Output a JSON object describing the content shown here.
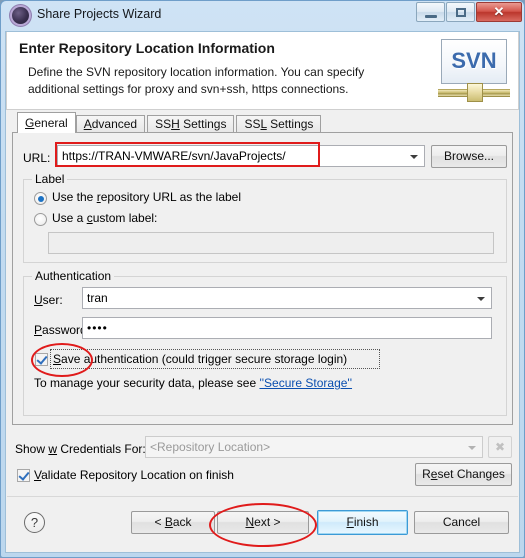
{
  "window": {
    "title": "Share Projects Wizard",
    "icon": "svn-repository-icon",
    "buttons": {
      "minimize": "minimize-icon",
      "maximize": "restore-icon",
      "close": "✕"
    }
  },
  "header": {
    "title": "Enter Repository Location Information",
    "description": "Define the SVN repository location information. You can specify additional settings for proxy and svn+ssh, https connections.",
    "badge_text": "SVN"
  },
  "tabs": [
    {
      "label_pre": "",
      "label_key": "G",
      "label_post": "eneral",
      "selected": true
    },
    {
      "label_pre": "",
      "label_key": "A",
      "label_post": "dvanced",
      "selected": false
    },
    {
      "label_pre": "SS",
      "label_key": "H",
      "label_post": " Settings",
      "selected": false
    },
    {
      "label_pre": "SS",
      "label_key": "L",
      "label_post": " Settings",
      "selected": false
    }
  ],
  "general": {
    "url_label": "URL:",
    "url_value": "https://TRAN-VMWARE/svn/JavaProjects/",
    "browse_label": "Browse...",
    "label_group": {
      "title": "Label",
      "radio_url_pre": "Use the ",
      "radio_url_key": "r",
      "radio_url_post": "epository URL as the label",
      "radio_url_selected": true,
      "radio_custom_pre": "Use a ",
      "radio_custom_key": "c",
      "radio_custom_post": "ustom label:",
      "radio_custom_selected": false,
      "custom_value": "",
      "custom_placeholder": ""
    },
    "auth_group": {
      "title": "Authentication",
      "user_label_key": "U",
      "user_label_post": "ser:",
      "user_value": "tran",
      "password_label_key": "P",
      "password_label_post": "assword:",
      "password_value": "••••",
      "save_auth_key": "S",
      "save_auth_post": "ave authentication (could trigger secure storage login)",
      "save_auth_checked": true,
      "secure_note": "To manage your security data, please see ",
      "secure_link": "''Secure Storage''"
    }
  },
  "footer": {
    "show_credentials_pre": "Show ",
    "show_credentials_key": "w",
    "show_credentials_post": " Credentials For:",
    "credentials_value": "<Repository Location>",
    "clear_button": "✖",
    "validate_key": "V",
    "validate_post": "alidate Repository Location on finish",
    "validate_checked": true,
    "reset_pre": "R",
    "reset_key": "e",
    "reset_post": "set Changes"
  },
  "buttons": {
    "help": "?",
    "back_pre": "< ",
    "back_key": "B",
    "back_post": "ack",
    "next_key": "N",
    "next_post": "ext >",
    "finish_key": "F",
    "finish_post": "inish",
    "cancel": "Cancel"
  },
  "annotations": {
    "url_highlight": "red-rectangle",
    "save_auth_highlight": "red-ellipse",
    "next_highlight": "red-ellipse",
    "color": "#e01b1b"
  },
  "colors": {
    "accent": "#1c72c4",
    "link": "#0b4fb0",
    "annotation": "#e01b1b",
    "svn_blue": "#3c6bad"
  }
}
